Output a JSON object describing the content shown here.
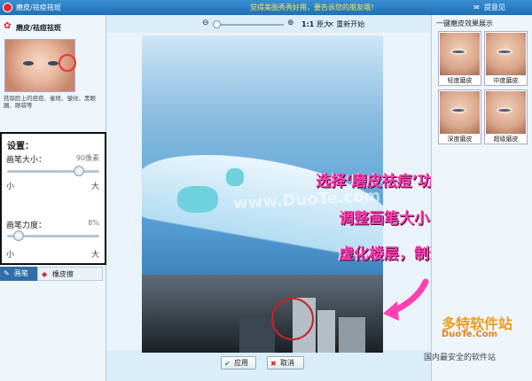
{
  "titlebar": {
    "title": "磨皮/祛痘祛斑",
    "promo": "觉得美图秀秀好用，要告诉您的朋友哦！",
    "feedback": "提意见"
  },
  "left_panel": {
    "header": "磨皮/祛痘祛斑",
    "description": "祛除脸上的痘痘、雀斑、皱纹、黑眼圈、眼袋等",
    "settings_title": "设置：",
    "brush_size_label": "画笔大小：",
    "brush_size_value": "90像素",
    "brush_size_level": 0.82,
    "brush_force_label": "画笔力度：",
    "brush_force_value": "8%",
    "brush_force_level": 0.08,
    "min_label": "小",
    "max_label": "大",
    "tab_brush": "画笔",
    "tab_eraser": "橡皮擦"
  },
  "toolbar": {
    "actual_size_ratio": "1:1",
    "actual_size_label": "原大",
    "restart": "重新开始"
  },
  "canvas": {
    "watermark": "www.DuoTe.com"
  },
  "annotations": [
    "选择‘磨皮祛痘’功能",
    "调整画笔大小、力度",
    "虚化楼层，制造景深"
  ],
  "bottom": {
    "apply": "应用",
    "cancel": "取消"
  },
  "right_panel": {
    "title": "一键磨皮效果展示",
    "effects": [
      "轻度磨皮",
      "中度磨皮",
      "深度磨皮",
      "超级磨皮"
    ]
  },
  "site_logo": {
    "name": "多特软件站",
    "domain": "DuoTe.Com",
    "tagline": "国内最安全的软件站"
  },
  "colors": {
    "annotation": "#ff3fb4",
    "titlebar": "#2a7cc2",
    "site_logo": "#f39a1b"
  }
}
